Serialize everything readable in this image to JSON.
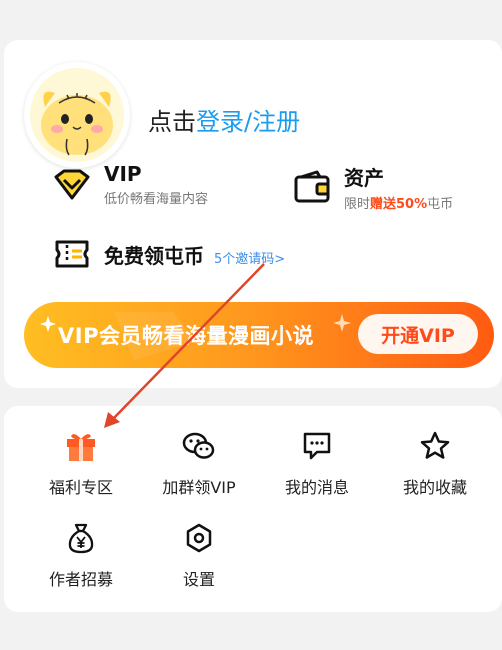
{
  "profile": {
    "login_prefix": "点击",
    "login_link": "登录/注册"
  },
  "features": {
    "vip": {
      "title": "VIP",
      "subtitle": "低价畅看海量内容"
    },
    "assets": {
      "title": "资产",
      "subtitle_before": "限时",
      "subtitle_highlight": "赠送50%",
      "subtitle_after": "屯币"
    },
    "coins": {
      "title": "免费领屯币",
      "invite_link": "5个邀请码>"
    }
  },
  "banner": {
    "text": "VIP会员畅看海量漫画小说",
    "button": "开通VIP"
  },
  "menu": {
    "items": [
      {
        "label": "福利专区",
        "icon": "gift-icon"
      },
      {
        "label": "加群领VIP",
        "icon": "wechat-icon"
      },
      {
        "label": "我的消息",
        "icon": "message-icon"
      },
      {
        "label": "我的收藏",
        "icon": "star-icon"
      },
      {
        "label": "作者招募",
        "icon": "money-bag-icon"
      },
      {
        "label": "设置",
        "icon": "settings-icon"
      }
    ]
  },
  "colors": {
    "link": "#1a9cf0",
    "accent": "#ff4a1a",
    "banner_start": "#ffbe22",
    "banner_end": "#ff5b12",
    "annotation_arrow": "#e0442a"
  }
}
